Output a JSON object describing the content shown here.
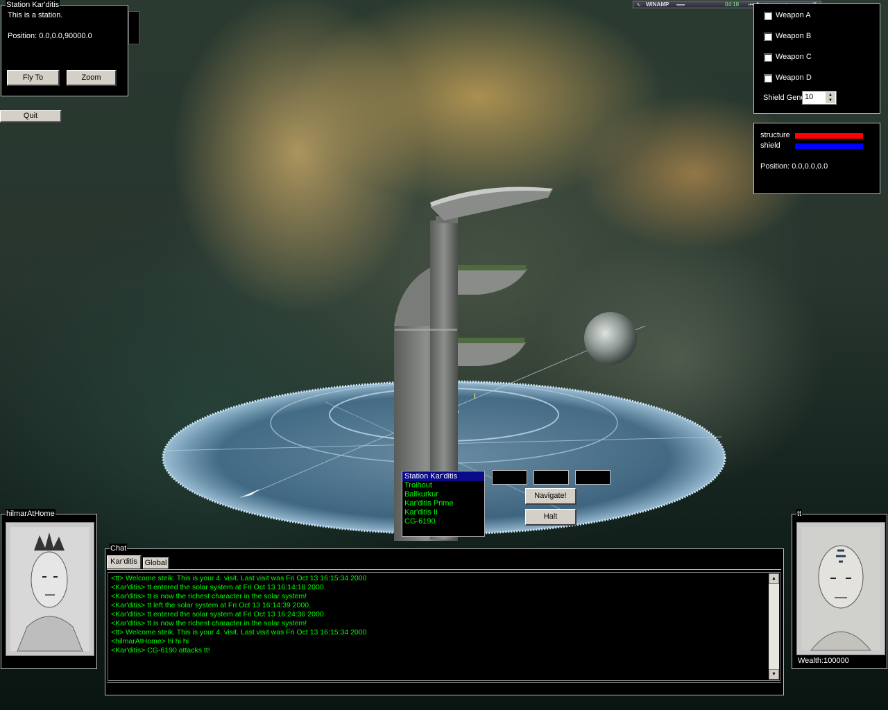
{
  "station_panel": {
    "title": "Station Kar'ditis",
    "description": "This is a station.",
    "position": "Position: 0.0,0.0,90000.0",
    "fly_to_label": "Fly To",
    "zoom_label": "Zoom"
  },
  "quit_label": "Quit",
  "winamp": {
    "title": "WINAMP",
    "time": "04:18"
  },
  "weapons": {
    "items": [
      "Weapon A",
      "Weapon B",
      "Weapon C",
      "Weapon D"
    ],
    "shield_label": "Shield Gene",
    "shield_value": "10"
  },
  "status": {
    "structure_label": "structure",
    "shield_label": "shield",
    "structure_color": "#ff0000",
    "shield_color": "#0000ff",
    "position": "Position: 0.0,0.0,0.0"
  },
  "nav": {
    "targets": [
      "Station Kar'ditis",
      "Troihout",
      "Ballkurkur",
      "Kar'ditis Prime",
      "Kar'ditis II",
      "CG-6190"
    ],
    "selected_index": 0,
    "navigate_label": "Navigate!",
    "halt_label": "Halt"
  },
  "player_left": {
    "name": "hilmarAtHome"
  },
  "player_right": {
    "name": "tt",
    "wealth": "Wealth:100000"
  },
  "chat": {
    "title": "Chat",
    "tabs": [
      "Kar'ditis",
      "Global"
    ],
    "active_tab": 0,
    "lines": [
      "<tt> Welcome steik.  This is your 4. visit.  Last visit was Fri Oct 13 16:15:34 2000",
      "<Kar'ditis> tt entered the solar system at Fri Oct 13 16:14:18 2000.",
      "<Kar'ditis> tt is now the richest character in the solar system!",
      "<Kar'ditis> tt left the solar system at Fri Oct 13 16:14:39 2000.",
      "<Kar'ditis> tt entered the solar system at Fri Oct 13 16:24:36 2000.",
      "<Kar'ditis> tt is now the richest character in the solar system!",
      "<tt> Welcome steik.  This is your 4. visit.  Last visit was Fri Oct 13 16:15:34 2000",
      "<hilmarAtHome> hi hi hi",
      "<Kar'ditis> CG-6190 attacks tt!"
    ]
  }
}
